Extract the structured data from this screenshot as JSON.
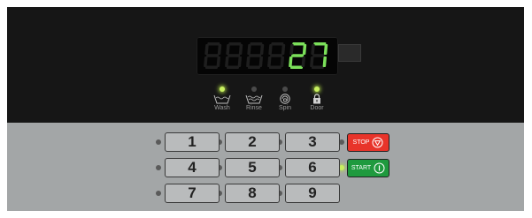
{
  "display": {
    "digits": [
      "",
      "",
      "",
      "",
      "2",
      "7"
    ]
  },
  "indicators": [
    {
      "name": "wash",
      "label": "Wash",
      "on": true,
      "icon": "wash-tub-icon"
    },
    {
      "name": "rinse",
      "label": "Rinse",
      "on": false,
      "icon": "rinse-tub-icon"
    },
    {
      "name": "spin",
      "label": "Spin",
      "on": false,
      "icon": "spin-spiral-icon"
    },
    {
      "name": "door",
      "label": "Door",
      "on": true,
      "icon": "padlock-icon"
    }
  ],
  "keypad": {
    "keys": [
      "1",
      "2",
      "3",
      "4",
      "5",
      "6",
      "7",
      "8",
      "9"
    ],
    "active_led": "start"
  },
  "controls": {
    "stop_label": "STOP",
    "start_label": "START"
  },
  "colors": {
    "segment_on": "#7be05a",
    "segment_off": "#1e1e1e",
    "led_on": "#c8f060",
    "stop": "#e8342a",
    "start": "#1f9a3e"
  }
}
